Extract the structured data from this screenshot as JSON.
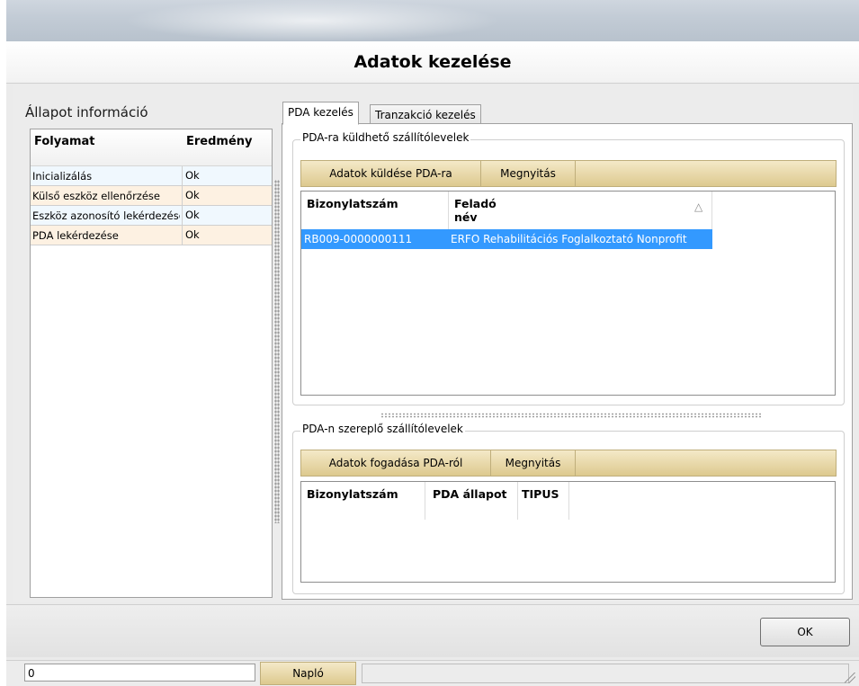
{
  "dialog": {
    "title": "Adatok kezelése"
  },
  "status_panel": {
    "title": "Állapot információ",
    "columns": [
      "Folyamat",
      "Eredmény"
    ],
    "rows": [
      {
        "process": "Inicializálás",
        "result": "Ok"
      },
      {
        "process": "Külső eszköz ellenőrzése",
        "result": "Ok"
      },
      {
        "process": "Eszköz azonosító lekérdezése",
        "result": "Ok"
      },
      {
        "process": "PDA lekérdezése",
        "result": "Ok"
      }
    ]
  },
  "tabs": [
    {
      "label": "PDA kezelés",
      "active": true
    },
    {
      "label": "Tranzakció kezelés",
      "active": false
    }
  ],
  "send_group": {
    "legend": "PDA-ra küldhető szállítólevelek",
    "buttons": [
      "Adatok küldése PDA-ra",
      "Megnyitás"
    ],
    "columns": [
      "Bizonylatszám",
      "Feladó név"
    ],
    "rows": [
      {
        "doc": "RB009-0000000111",
        "sender": "ERFO Rehabilitációs Foglalkoztató Nonprofit"
      }
    ],
    "sort_icon": "sort-triangle-icon"
  },
  "receive_group": {
    "legend": "PDA-n szereplő szállítólevelek",
    "buttons": [
      "Adatok fogadása PDA-ról",
      "Megnyitás"
    ],
    "columns": [
      "Bizonylatszám",
      "PDA állapot",
      "TIPUS"
    ]
  },
  "footer": {
    "ok_label": "OK",
    "status_value": "0",
    "log_label": "Napló"
  },
  "colors": {
    "selection": "#3399ff",
    "toolbar": "#ddc98e",
    "row_blue": "#f0f8fe",
    "row_orange": "#fdf1e2"
  }
}
